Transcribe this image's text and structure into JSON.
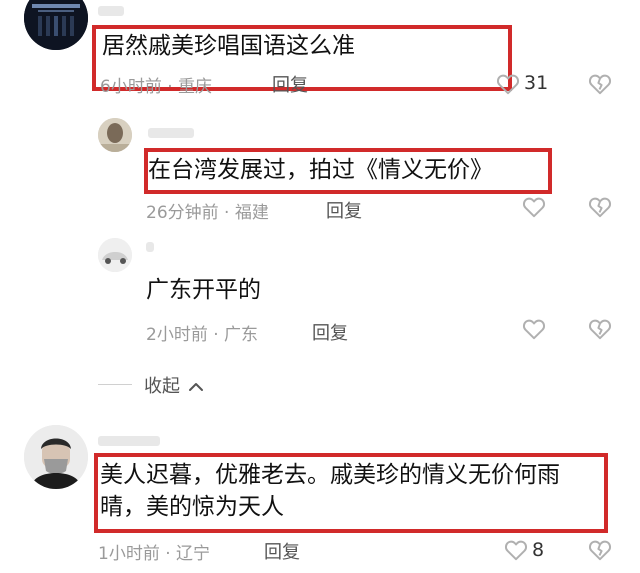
{
  "comments": [
    {
      "text": "居然戚美珍唱国语这么准",
      "time": "6小时前",
      "location": "重庆",
      "reply_label": "回复",
      "like_count": "31"
    },
    {
      "text": "在台湾发展过，拍过《情义无价》",
      "time": "26分钟前",
      "location": "福建",
      "reply_label": "回复"
    },
    {
      "text": "广东开平的",
      "time": "2小时前",
      "location": "广东",
      "reply_label": "回复"
    },
    {
      "text": "美人迟暮，优雅老去。戚美珍的情义无价何雨晴，美的惊为天人",
      "time": "1小时前",
      "location": "辽宁",
      "reply_label": "回复",
      "like_count": "8"
    }
  ],
  "collapse_label": "收起",
  "meta_separator": "·",
  "icons": {
    "like": "heart-outline-icon",
    "dislike": "broken-heart-icon",
    "collapse": "chevron-up-icon"
  },
  "colors": {
    "highlight_box": "#d12a2a",
    "meta_text": "#9a9a9a",
    "icon_stroke": "#b0b0b0"
  }
}
